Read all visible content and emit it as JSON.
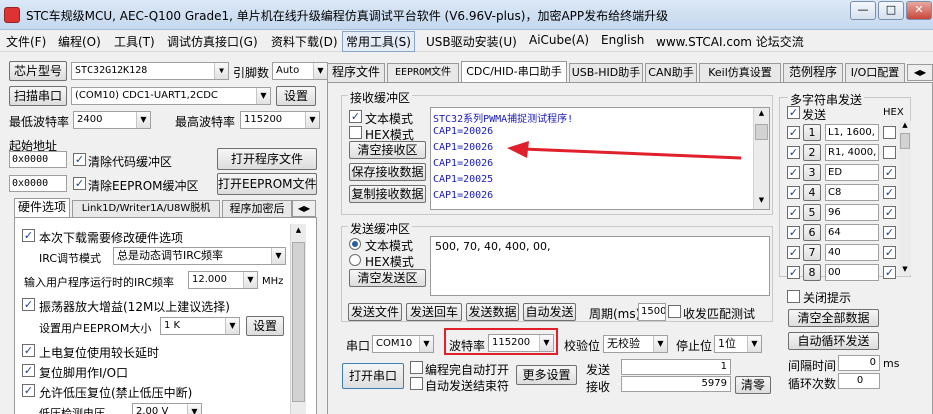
{
  "window": {
    "title": "STC车规级MCU, AEC-Q100 Grade1, 单片机在线升级编程仿真调试平台软件 (V6.96V-plus)，加密APP发布给终端升级",
    "btn_min": "—",
    "btn_max": "□",
    "btn_close": "✕"
  },
  "menu": [
    "文件(F)",
    "编程(O)",
    "工具(T)",
    "调试仿真接口(G)",
    "资料下载(D)",
    "常用工具(S)",
    "USB驱动安装(U)",
    "AiCube(A)",
    "English",
    "www.STCAI.com 论坛交流"
  ],
  "left": {
    "chip_label": "芯片型号",
    "chip_value": "STC32G12K128",
    "pin_label": "引脚数",
    "pin_value": "Auto",
    "scan_label": "扫描串口",
    "port_value": "(COM10) CDC1-UART1,2CDC",
    "settings_label": "设置",
    "min_baud_label": "最低波特率",
    "min_baud_value": "2400",
    "max_baud_label": "最高波特率",
    "max_baud_value": "115200",
    "start_addr_label": "起始地址",
    "addr1": "0x0000",
    "clear_code_label": "清除代码缓冲区",
    "open_prog_label": "打开程序文件",
    "addr2": "0x0000",
    "clear_eeprom_label": "清除EEPROM缓冲区",
    "open_eeprom_label": "打开EEPROM文件",
    "tabs": [
      "硬件选项",
      "Link1D/Writer1A/U8W脱机",
      "程序加密后"
    ],
    "hw_opt1": "本次下载需要修改硬件选项",
    "irc_label": "IRC调节模式",
    "irc_value": "总是动态调节IRC频率",
    "freq_label": "输入用户程序运行时的IRC频率",
    "freq_value": "12.000",
    "freq_unit": "MHz",
    "hw_opt2": "振荡器放大增益(12M以上建议选择)",
    "eeprom_size_label": "设置用户EEPROM大小",
    "eeprom_size_value": "1   K",
    "eeprom_set_label": "设置",
    "hw_opt3": "上电复位使用较长延时",
    "hw_opt4": "复位脚用作I/O口",
    "hw_opt5": "允许低压复位(禁止低压中断)",
    "lvd_label": "低压检测电压",
    "lvd_value": "2.00 V"
  },
  "right_tabs": [
    "程序文件",
    "EEPROM文件",
    "CDC/HID-串口助手",
    "USB-HID助手",
    "CAN助手",
    "Keil仿真设置",
    "范例程序",
    "I/O口配置"
  ],
  "serial": {
    "recv_group": "接收缓冲区",
    "text_mode": "文本模式",
    "hex_mode": "HEX模式",
    "clear_recv": "清空接收区",
    "save_recv": "保存接收数据",
    "copy_recv": "复制接收数据",
    "recv_lines": [
      "STC32系列PWMA捕捉测试程序!",
      "CAP1=20026",
      "CAP1=20026",
      "CAP1=20026",
      "CAP1=20025",
      "CAP1=20026"
    ],
    "send_group": "发送缓冲区",
    "send_text_mode": "文本模式",
    "send_hex_mode": "HEX模式",
    "clear_send": "清空发送区",
    "send_content": "500, 70, 40, 400, 00,",
    "send_file": "发送文件",
    "send_enter": "发送回车",
    "send_data": "发送数据",
    "auto_send": "自动发送",
    "period_label": "周期(ms)",
    "period_value": "1500",
    "match_label": "收发匹配测试",
    "port_label": "串口",
    "port_value": "COM10",
    "baud_label": "波特率",
    "baud_value": "115200",
    "parity_label": "校验位",
    "parity_value": "无校验",
    "stop_label": "停止位",
    "stop_value": "1位",
    "open_port": "打开串口",
    "opt_auto_open": "编程完自动打开",
    "opt_auto_close": "自动发送结束符",
    "more_settings": "更多设置",
    "send_count_label": "发送",
    "send_count": "1",
    "recv_count_label": "接收",
    "recv_count": "5979",
    "clear_counts": "清零"
  },
  "multi": {
    "group": "多字符串发送",
    "send_label": "发送",
    "hex_label": "HEX",
    "rows": [
      {
        "num": "1",
        "text": "L1, 1600, 0",
        "hex": false
      },
      {
        "num": "2",
        "text": "R1, 4000, 1",
        "hex": false
      },
      {
        "num": "3",
        "text": "ED",
        "hex": true
      },
      {
        "num": "4",
        "text": "C8",
        "hex": true
      },
      {
        "num": "5",
        "text": "96",
        "hex": true
      },
      {
        "num": "6",
        "text": "64",
        "hex": true
      },
      {
        "num": "7",
        "text": "40",
        "hex": true
      },
      {
        "num": "8",
        "text": "00",
        "hex": true
      }
    ],
    "close_hint": "关闭提示",
    "clear_all": "清空全部数据",
    "auto_loop": "自动循环发送",
    "interval_label": "间隔时间",
    "interval_value": "0",
    "interval_unit": "ms",
    "loop_label": "循环次数",
    "loop_value": "0"
  },
  "colors": {
    "arrow": "#e0202a",
    "highlight_box": "#e0202a",
    "recv_text": "#1a1ab8"
  }
}
